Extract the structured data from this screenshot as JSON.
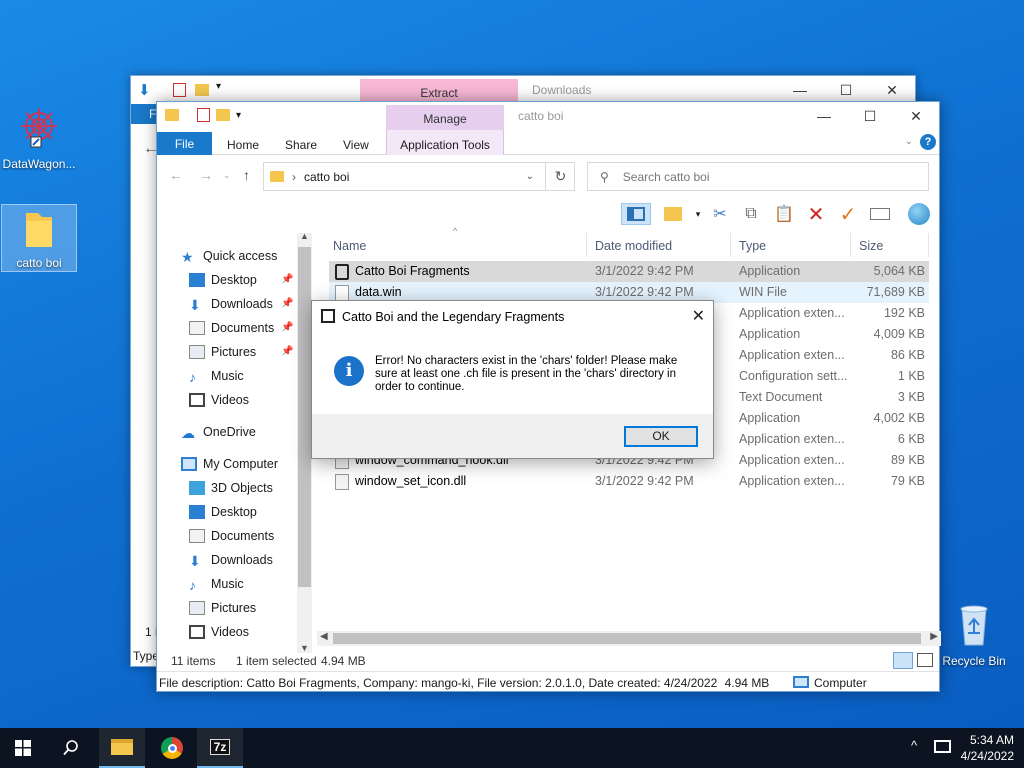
{
  "desktop": {
    "icons": [
      {
        "label": "DataWagon..."
      },
      {
        "label": "catto boi"
      },
      {
        "label": "Recycle Bin"
      }
    ]
  },
  "back_window": {
    "context_tab": "Extract",
    "title": "Downloads",
    "ribbon_file": "F",
    "status_type": "Type",
    "status_1": "1 i"
  },
  "window": {
    "context_tab": "Manage",
    "title": "catto boi",
    "ribbon": {
      "file": "File",
      "tabs": [
        "Home",
        "Share",
        "View"
      ],
      "app_tools": "Application Tools",
      "help": "?"
    },
    "address": {
      "path": "catto boi",
      "separator": "›"
    },
    "search": {
      "placeholder": "Search catto boi"
    },
    "nav": {
      "quick_access": "Quick access",
      "qa_items": [
        "Desktop",
        "Downloads",
        "Documents",
        "Pictures",
        "Music",
        "Videos"
      ],
      "onedrive": "OneDrive",
      "my_computer": "My Computer",
      "pc_items": [
        "3D Objects",
        "Desktop",
        "Documents",
        "Downloads",
        "Music",
        "Pictures",
        "Videos"
      ]
    },
    "columns": [
      "Name",
      "Date modified",
      "Type",
      "Size"
    ],
    "files": [
      {
        "name": "Catto Boi Fragments",
        "date": "3/1/2022 9:42 PM",
        "type": "Application",
        "size": "5,064 KB"
      },
      {
        "name": "data.win",
        "date": "3/1/2022 9:42 PM",
        "type": "WIN File",
        "size": "71,689 KB"
      },
      {
        "name": "",
        "date": "",
        "type": "Application exten...",
        "size": "192 KB"
      },
      {
        "name": "",
        "date": "",
        "type": "Application",
        "size": "4,009 KB"
      },
      {
        "name": "",
        "date": "",
        "type": "Application exten...",
        "size": "86 KB"
      },
      {
        "name": "",
        "date": "",
        "type": "Configuration sett...",
        "size": "1 KB"
      },
      {
        "name": "",
        "date": "",
        "type": "Text Document",
        "size": "3 KB"
      },
      {
        "name": "",
        "date": "",
        "type": "Application",
        "size": "4,002 KB"
      },
      {
        "name": "",
        "date": "",
        "type": "Application exten...",
        "size": "6 KB"
      },
      {
        "name": "window_command_hook.dll",
        "date": "3/1/2022 9:42 PM",
        "type": "Application exten...",
        "size": "89 KB"
      },
      {
        "name": "window_set_icon.dll",
        "date": "3/1/2022 9:42 PM",
        "type": "Application exten...",
        "size": "79 KB"
      }
    ],
    "status": {
      "count": "11 items",
      "selected": "1 item selected",
      "size": "4.94 MB"
    },
    "details_bar": {
      "description": "File description: Catto Boi Fragments, Company: mango-ki, File version: 2.0.1.0, Date created: 4/24/2022",
      "size": "4.94 MB",
      "computer": "Computer"
    }
  },
  "dialog": {
    "title": "Catto Boi and the Legendary Fragments",
    "message": "Error! No characters exist in the 'chars' folder! Please make sure at least one .ch file is present in the 'chars' directory in order to continue.",
    "ok": "OK"
  },
  "taskbar": {
    "time": "5:34 AM",
    "date": "4/24/2022",
    "apps": [
      "start-icon",
      "search-icon",
      "file-explorer-icon",
      "chrome-icon",
      "7zip-icon"
    ],
    "seven_zip_label": "7z"
  },
  "colors": {
    "accent": "#1979ca",
    "manage_tab": "#e5ceee",
    "extract_tab": "#f7b8d4"
  }
}
